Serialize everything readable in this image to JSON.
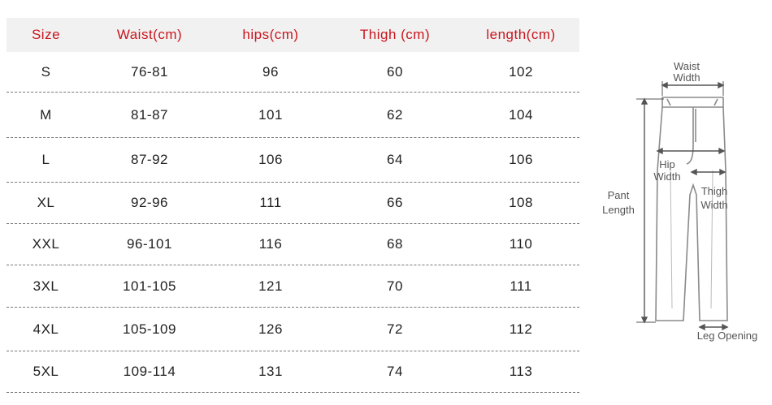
{
  "table": {
    "headers": [
      "Size",
      "Waist(cm)",
      "hips(cm)",
      "Thigh (cm)",
      "length(cm)"
    ],
    "rows": [
      [
        "S",
        "76-81",
        "96",
        "60",
        "102"
      ],
      [
        "M",
        "81-87",
        "101",
        "62",
        "104"
      ],
      [
        "L",
        "87-92",
        "106",
        "64",
        "106"
      ],
      [
        "XL",
        "92-96",
        "111",
        "66",
        "108"
      ],
      [
        "XXL",
        "96-101",
        "116",
        "68",
        "110"
      ],
      [
        "3XL",
        "101-105",
        "121",
        "70",
        "111"
      ],
      [
        "4XL",
        "105-109",
        "126",
        "72",
        "112"
      ],
      [
        "5XL",
        "109-114",
        "131",
        "74",
        "113"
      ]
    ]
  },
  "diagram": {
    "waist_line1": "Waist",
    "waist_line2": "Width",
    "hip_line1": "Hip",
    "hip_line2": "Width",
    "thigh_line1": "Thigh",
    "thigh_line2": "Width",
    "pant_line1": "Pant",
    "pant_line2": "Length",
    "leg_opening": "Leg Opening"
  }
}
